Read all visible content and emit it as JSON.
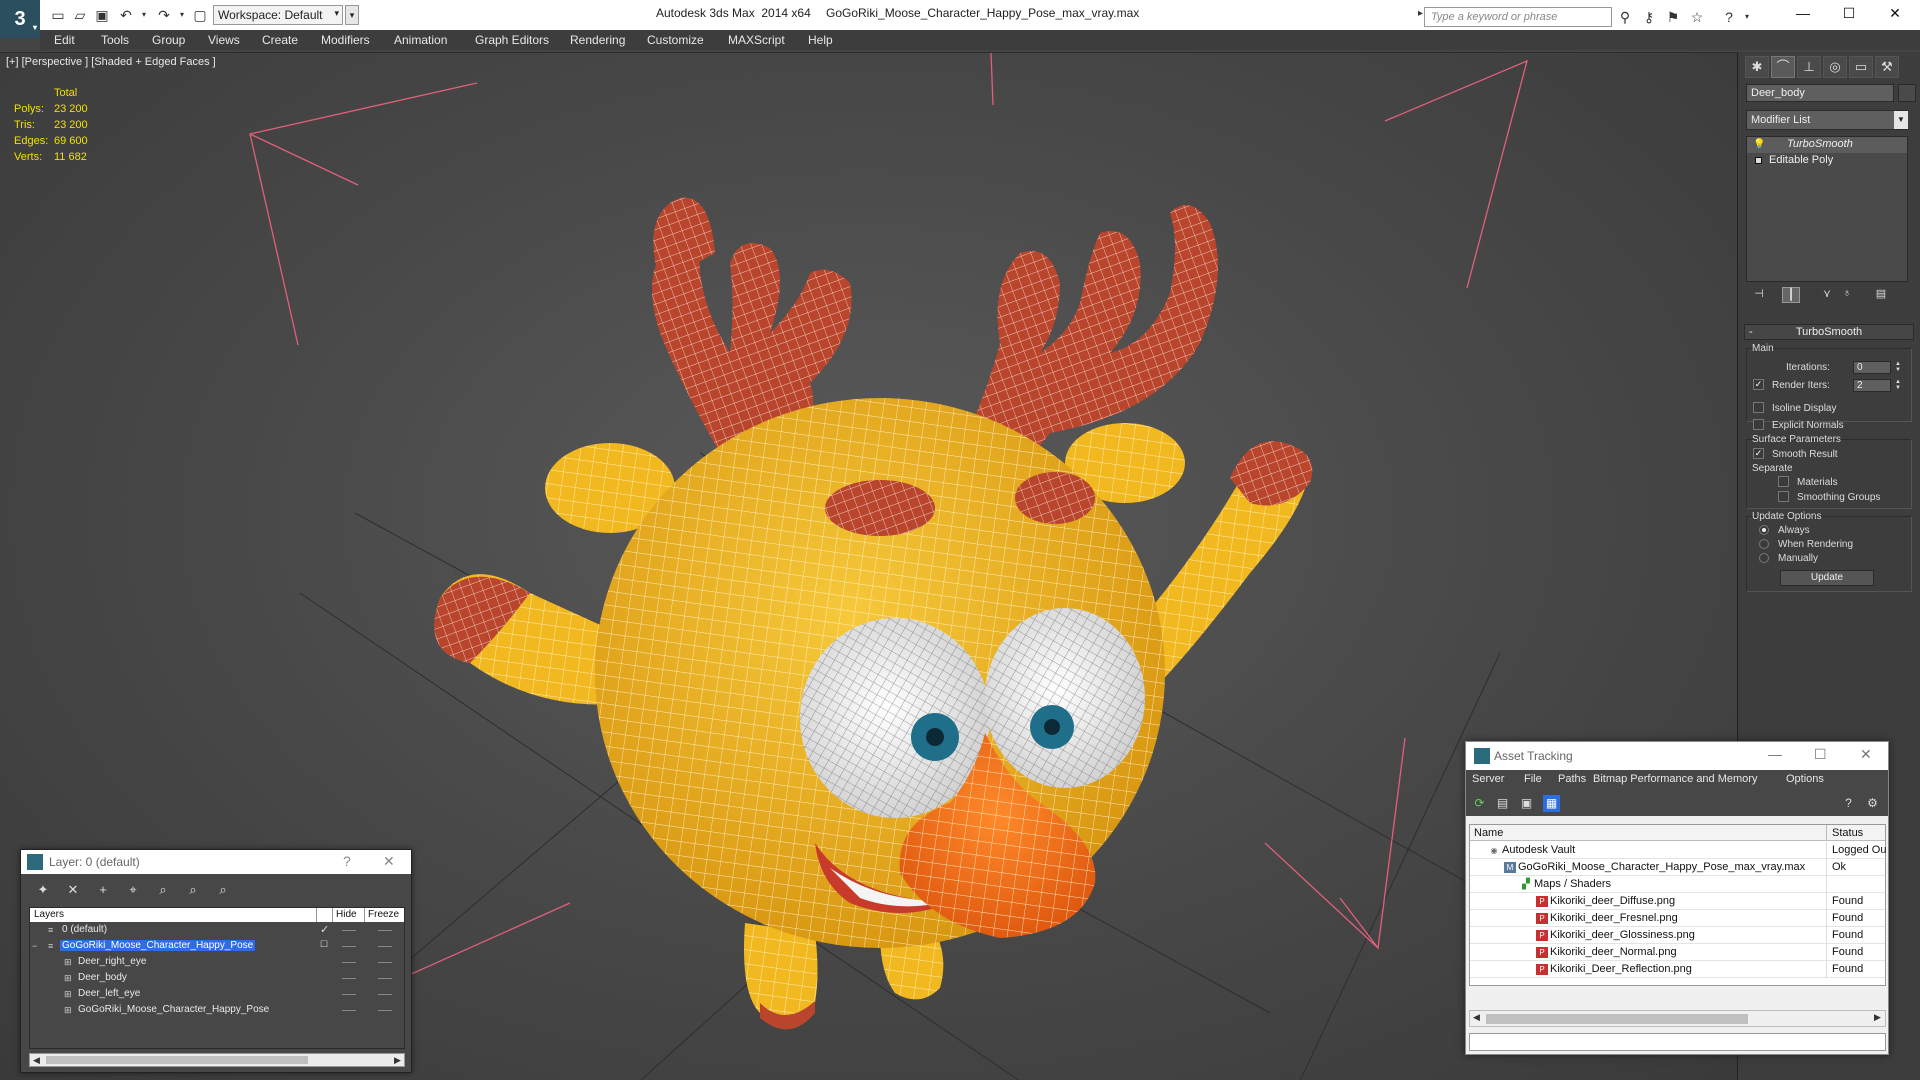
{
  "titlebar": {
    "workspace": "Workspace: Default",
    "app_title": "Autodesk 3ds Max  2014 x64",
    "file_title": "GoGoRiki_Moose_Character_Happy_Pose_max_vray.max",
    "search_placeholder": "Type a keyword or phrase"
  },
  "menu": [
    "Edit",
    "Tools",
    "Group",
    "Views",
    "Create",
    "Modifiers",
    "Animation",
    "Graph Editors",
    "Rendering",
    "Customize",
    "MAXScript",
    "Help"
  ],
  "viewport": {
    "label": "[+] [Perspective ] [Shaded + Edged Faces ]",
    "stats": {
      "header": "Total",
      "rows": [
        {
          "key": "Polys:",
          "value": "23 200"
        },
        {
          "key": "Tris:",
          "value": "23 200"
        },
        {
          "key": "Edges:",
          "value": "69 600"
        },
        {
          "key": "Verts:",
          "value": "11 682"
        }
      ]
    }
  },
  "command_panel": {
    "object_name": "Deer_body",
    "modifier_list": "Modifier List",
    "stack": [
      "TurboSmooth",
      "Editable Poly"
    ],
    "rollout": {
      "title": "TurboSmooth",
      "main": "Main",
      "iterations_label": "Iterations:",
      "iterations_value": "0",
      "render_iters_label": "Render Iters:",
      "render_iters_value": "2",
      "render_iters_checked": true,
      "isoline": "Isoline Display",
      "explicit_normals": "Explicit Normals",
      "surface_params": "Surface Parameters",
      "smooth_result": "Smooth Result",
      "smooth_result_checked": true,
      "separate": "Separate",
      "materials": "Materials",
      "smoothing_groups": "Smoothing Groups",
      "update_options": "Update Options",
      "always": "Always",
      "when_rendering": "When Rendering",
      "manually": "Manually",
      "update_button": "Update",
      "selected_update_option": "Always"
    }
  },
  "layer_window": {
    "title": "Layer: 0 (default)",
    "columns": [
      "Layers",
      "Hide",
      "Freeze"
    ],
    "rows": [
      {
        "name": "0 (default)",
        "current": true,
        "selected": false
      },
      {
        "name": "GoGoRiki_Moose_Character_Happy_Pose",
        "current": false,
        "selected": true
      },
      {
        "name": "Deer_right_eye",
        "current": false,
        "selected": false
      },
      {
        "name": "Deer_body",
        "current": false,
        "selected": false
      },
      {
        "name": "Deer_left_eye",
        "current": false,
        "selected": false
      },
      {
        "name": "GoGoRiki_Moose_Character_Happy_Pose",
        "current": false,
        "selected": false
      }
    ]
  },
  "asset_window": {
    "title": "Asset Tracking",
    "menu": [
      "Server",
      "File",
      "Paths",
      "Bitmap Performance and Memory",
      "Options"
    ],
    "columns": [
      "Name",
      "Status"
    ],
    "rows": [
      {
        "name": "Autodesk Vault",
        "status": "Logged Ou",
        "icon": "vault-icon"
      },
      {
        "name": "GoGoRiki_Moose_Character_Happy_Pose_max_vray.max",
        "status": "Ok",
        "icon": "max-file-icon"
      },
      {
        "name": "Maps / Shaders",
        "status": "",
        "icon": "maps-icon"
      },
      {
        "name": "Kikoriki_deer_Diffuse.png",
        "status": "Found",
        "icon": "png-icon"
      },
      {
        "name": "Kikoriki_deer_Fresnel.png",
        "status": "Found",
        "icon": "png-icon"
      },
      {
        "name": "Kikoriki_deer_Glossiness.png",
        "status": "Found",
        "icon": "png-icon"
      },
      {
        "name": "Kikoriki_deer_Normal.png",
        "status": "Found",
        "icon": "png-icon"
      },
      {
        "name": "Kikoriki_Deer_Reflection.png",
        "status": "Found",
        "icon": "png-icon"
      }
    ]
  },
  "colors": {
    "accent": "#2c6de0",
    "stats_yellow": "#f0e000",
    "body_yellow": "#f2b820",
    "antler_red": "#b8452c",
    "nose_orange": "#f07020",
    "selection_pink": "#e0607a"
  }
}
